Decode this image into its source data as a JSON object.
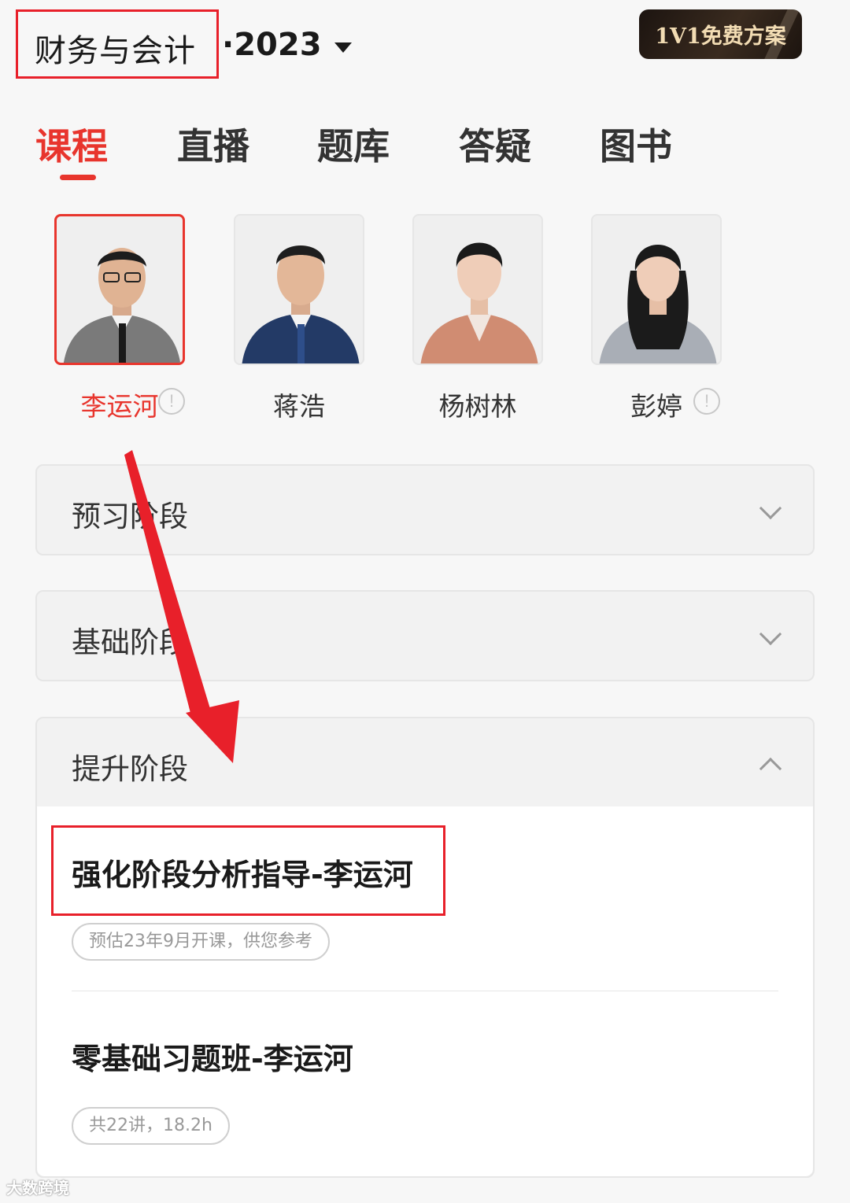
{
  "header": {
    "subject": "财务与会计",
    "year": "·2023",
    "promo_label": "1V1免费方案"
  },
  "tabs": [
    {
      "label": "课程",
      "active": true
    },
    {
      "label": "直播",
      "active": false
    },
    {
      "label": "题库",
      "active": false
    },
    {
      "label": "答疑",
      "active": false
    },
    {
      "label": "图书",
      "active": false
    }
  ],
  "teachers": [
    {
      "name": "李运河",
      "selected": true,
      "info": true
    },
    {
      "name": "蒋浩",
      "selected": false,
      "info": false
    },
    {
      "name": "杨树林",
      "selected": false,
      "info": false
    },
    {
      "name": "彭婷",
      "selected": false,
      "info": true
    }
  ],
  "info_glyph": "!",
  "stages": [
    {
      "title": "预习阶段",
      "expanded": false
    },
    {
      "title": "基础阶段",
      "expanded": false
    },
    {
      "title": "提升阶段",
      "expanded": true,
      "courses": [
        {
          "title": "强化阶段分析指导-李运河",
          "tag": "预估23年9月开课，供您参考"
        },
        {
          "title": "零基础习题班-李运河",
          "tag": "共22讲，18.2h"
        }
      ]
    }
  ],
  "watermark": "大数跨境",
  "colors": {
    "accent": "#e8352d",
    "annotation": "#e8202a",
    "promo_bg": "#2b2018",
    "promo_text": "#f2dcb3"
  }
}
